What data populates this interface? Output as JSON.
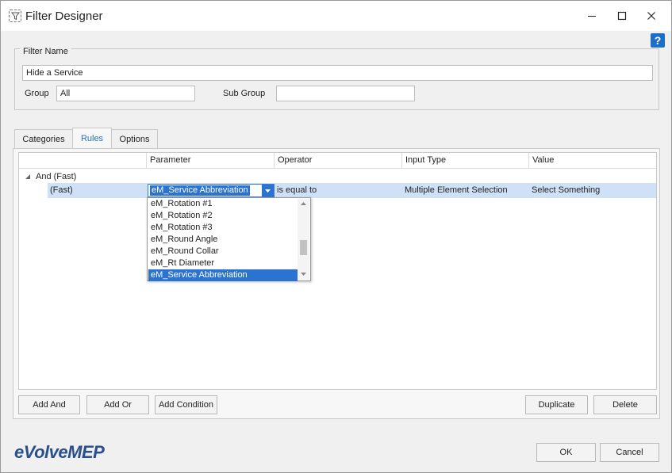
{
  "window": {
    "title": "Filter Designer"
  },
  "help": {
    "label": "?"
  },
  "filter": {
    "legend": "Filter Name",
    "name_value": "Hide a Service",
    "group_label": "Group",
    "group_value": "All",
    "subgroup_label": "Sub Group",
    "subgroup_value": ""
  },
  "tabs": [
    {
      "label": "Categories"
    },
    {
      "label": "Rules"
    },
    {
      "label": "Options"
    }
  ],
  "grid": {
    "columns": [
      "Parameter",
      "Operator",
      "Input Type",
      "Value"
    ],
    "group_row": "And (Fast)",
    "row": {
      "label": "(Fast)",
      "parameter": "eM_Service Abbreviation",
      "operator": "is equal to",
      "input_type": "Multiple Element Selection",
      "value": "Select Something"
    }
  },
  "dropdown": {
    "items": [
      "eM_Rotation #1",
      "eM_Rotation #2",
      "eM_Rotation #3",
      "eM_Round Angle",
      "eM_Round Collar",
      "eM_Rt Diameter",
      "eM_Service Abbreviation"
    ],
    "selected": "eM_Service Abbreviation"
  },
  "buttons": {
    "add_and": "Add And",
    "add_or": "Add Or",
    "add_condition": "Add Condition",
    "duplicate": "Duplicate",
    "delete": "Delete",
    "ok": "OK",
    "cancel": "Cancel"
  },
  "brand": "eVolveMEP",
  "colors": {
    "accent": "#2b73d0",
    "selection_row": "#cfe1f7",
    "brand": "#2a4f8c"
  }
}
